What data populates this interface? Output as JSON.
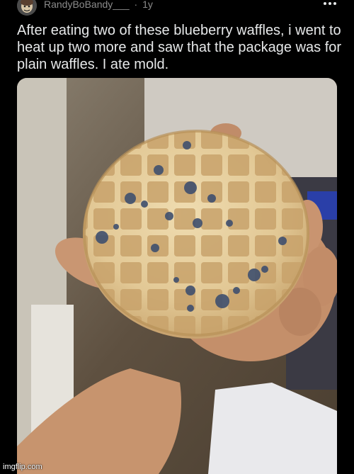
{
  "post": {
    "username": "RandyBoBandy___",
    "separator": "·",
    "age": "1y",
    "more_icon": "more-horizontal-icon",
    "caption": "After eating two of these blueberry waffles, i went to heat up two more and saw that the package was for plain waffles. I ate mold."
  },
  "watermark": "imgflip.com",
  "colors": {
    "background": "#000000",
    "text": "#e7e9ea",
    "muted": "#8b8b8b",
    "waffle": "#e2cc9e",
    "mold": "#3f4f6e"
  }
}
